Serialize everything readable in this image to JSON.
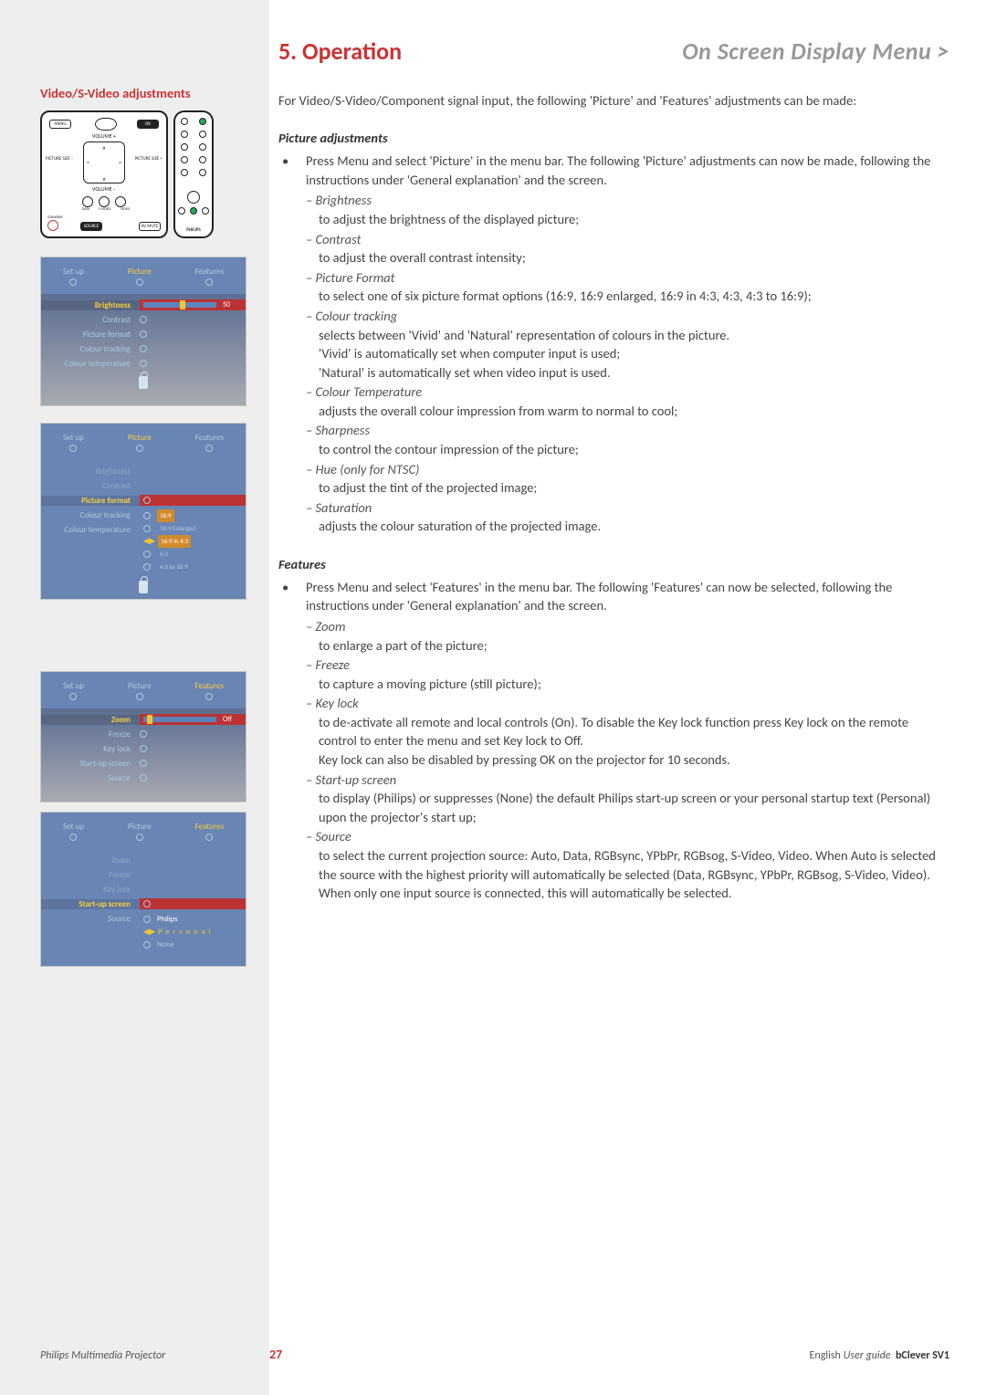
{
  "header": {
    "chapter": "5. Operation",
    "breadcrumb": "On Screen Display Menu >"
  },
  "sidebar": {
    "heading": "Video/S-Video adjustments",
    "remote": {
      "menu": "MENU",
      "ok": "OK",
      "vol_up": "VOLUME +",
      "vol_down": "VOLUME –",
      "pic_minus": "PICTURE SIZE –",
      "pic_plus": "PICTURE SIZE +",
      "standby": "STANDBY",
      "source": "SOURCE",
      "av_mute": "AV MUTE",
      "brand": "PHILIPS",
      "data": "DATA",
      "svideo": "S-VIDEO",
      "video": "VIDEO"
    },
    "osd1": {
      "tabs": [
        "Set up",
        "Picture",
        "Features"
      ],
      "active_tab": 1,
      "rows": [
        {
          "label": "Brightness",
          "hl": true,
          "val": "50",
          "slider": true
        },
        {
          "label": "Contrast"
        },
        {
          "label": "Picture format"
        },
        {
          "label": "Colour tracking"
        },
        {
          "label": "Colour temperature"
        }
      ]
    },
    "osd2": {
      "tabs": [
        "Set up",
        "Picture",
        "Features"
      ],
      "active_tab": 1,
      "dim": [
        "Brightness",
        "Contrast"
      ],
      "hl_row": "Picture format",
      "other_rows": [
        "Colour tracking",
        "Colour temperature"
      ],
      "sub": [
        {
          "t": "16:9",
          "sel": true
        },
        {
          "t": "16:9 Enlarged"
        },
        {
          "t": "16:9 in 4:3",
          "sel": true
        },
        {
          "t": "4:3"
        },
        {
          "t": "4:3 to 16:9"
        }
      ]
    },
    "osd3": {
      "tabs": [
        "Set up",
        "Picture",
        "Features"
      ],
      "active_tab": 2,
      "rows": [
        {
          "label": "Zoom",
          "hl": true,
          "val": "Off",
          "slider": true
        },
        {
          "label": "Freeze"
        },
        {
          "label": "Key lock"
        },
        {
          "label": "Start-up screen"
        },
        {
          "label": "Source"
        }
      ]
    },
    "osd4": {
      "tabs": [
        "Set up",
        "Picture",
        "Features"
      ],
      "active_tab": 2,
      "dim": [
        "Zoom",
        "Freeze",
        "Key lock"
      ],
      "hl_row": "Start-up screen",
      "other_rows": [
        "Source"
      ],
      "sub": [
        {
          "t": "Philips",
          "sel": true
        },
        {
          "t": "P e r  s o n a l",
          "sel": true,
          "dash": true
        },
        {
          "t": "None"
        }
      ]
    }
  },
  "main": {
    "intro": "For Video/S-Video/Component signal input, the following 'Picture' and 'Features' adjustments can be made:",
    "section1": {
      "title": "Picture adjustments",
      "lead": "Press Menu and select 'Picture' in the menu bar.  The following 'Picture' adjustments can now be made, following the instructions under 'General explanation' and the screen.",
      "items": [
        {
          "label": "– Brightness",
          "desc": "to adjust the brightness of the displayed picture;"
        },
        {
          "label": "– Contrast",
          "desc": "to adjust the overall contrast intensity;"
        },
        {
          "label": "– Picture Format",
          "desc": "to select one of six picture format options (16:9, 16:9 enlarged, 16:9 in 4:3, 4:3, 4:3 to 16:9);"
        },
        {
          "label": "– Colour tracking",
          "desc": "selects between 'Vivid' and 'Natural' representation of colours in the picture.\n'Vivid' is automatically set when computer input is used;\n'Natural' is automatically set when video input is used."
        },
        {
          "label": "– Colour Temperature",
          "desc": "adjusts the overall colour impression from warm to normal to cool;"
        },
        {
          "label": "– Sharpness",
          "desc": "to control the contour impression of the picture;"
        },
        {
          "label": "– Hue (only for NTSC)",
          "desc": "to adjust the tint of the projected image;"
        },
        {
          "label": "– Saturation",
          "desc": "adjusts the colour saturation of the projected image."
        }
      ]
    },
    "section2": {
      "title": "Features",
      "lead": "Press Menu and select 'Features' in the menu bar. The following 'Features' can now be selected, following the instructions under 'General explanation' and the screen.",
      "items": [
        {
          "label": "– Zoom",
          "desc": "to enlarge a part of the picture;"
        },
        {
          "label": "– Freeze",
          "desc": "to capture a moving picture (still picture);"
        },
        {
          "label": "– Key lock",
          "desc": "to de-activate all remote and local controls (On). To disable the Key lock function press Key lock on the remote control to enter the menu and set Key lock to Off.\nKey lock can also be disabled by pressing OK on the projector for 10 seconds."
        },
        {
          "label": "– Start-up screen",
          "desc": "to display (Philips) or suppresses (None) the default Philips start-up screen or your personal startup text (Personal) upon the projector's start up;"
        },
        {
          "label": "– Source",
          "desc": "to select the current projection source: Auto, Data, RGBsync, YPbPr, RGBsog, S-Video, Video. When Auto is selected the source with the highest priority will automatically be selected (Data, RGBsync, YPbPr, RGBsog, S-Video, Video). When only one input source is connected, this will automatically be selected."
        }
      ]
    }
  },
  "footer": {
    "left": "Philips Multimedia Projector",
    "page": "27",
    "right_lang": "English",
    "right_guide": "User guide",
    "right_model": "bClever SV1"
  }
}
